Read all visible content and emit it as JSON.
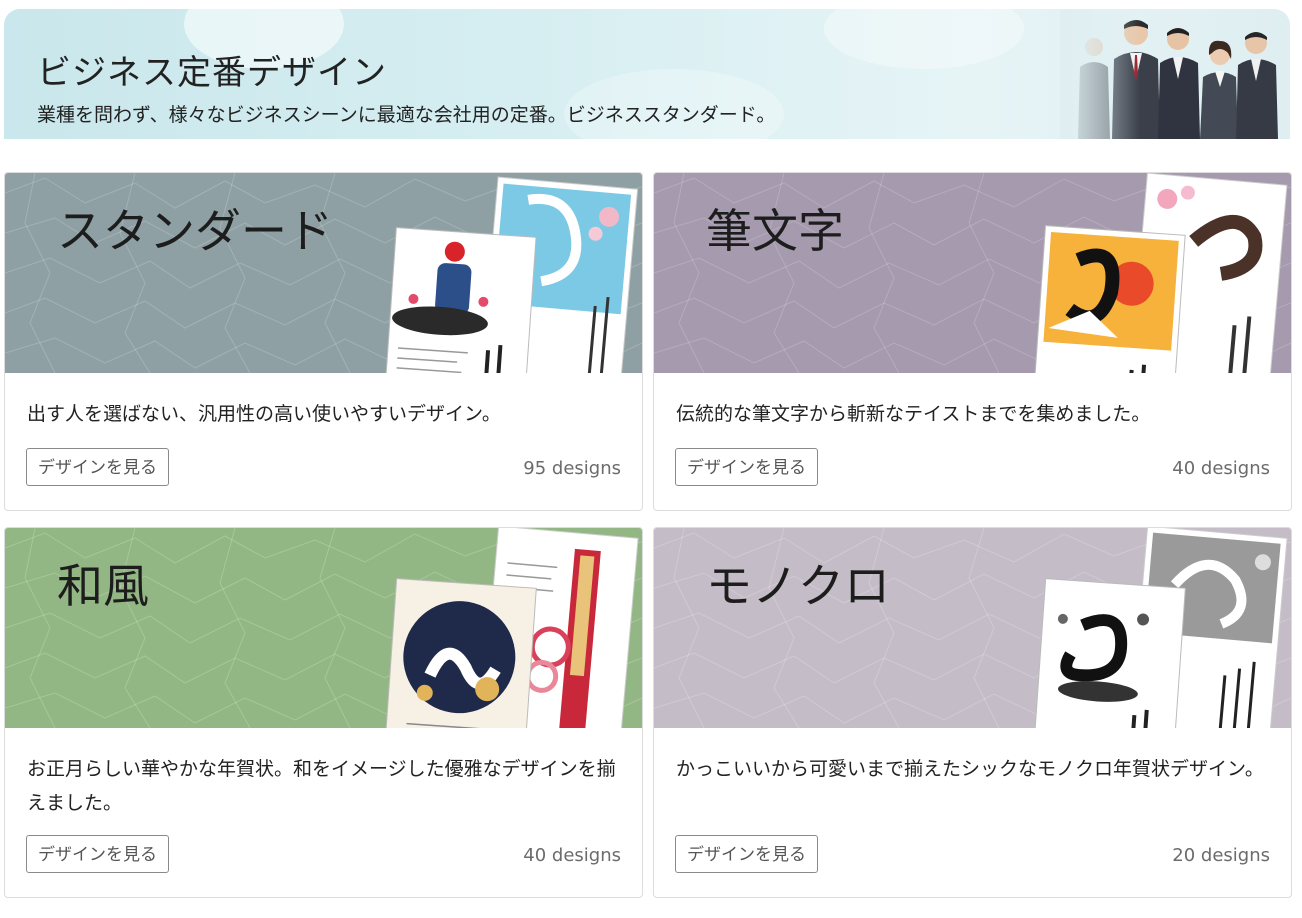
{
  "hero": {
    "title": "ビジネス定番デザイン",
    "subtitle": "業種を問わず、様々なビジネスシーンに最適な会社用の定番。ビジネススタンダード。"
  },
  "categories": [
    {
      "title": "スタンダード",
      "description": "出す人を選ばない、汎用性の高い使いやすいデザイン。",
      "button": "デザインを見る",
      "count": "95 designs",
      "banner_color": "#8fa0a4"
    },
    {
      "title": "筆文字",
      "description": "伝統的な筆文字から斬新なテイストまでを集めました。",
      "button": "デザインを見る",
      "count": "40 designs",
      "banner_color": "#a69aae"
    },
    {
      "title": "和風",
      "description": "お正月らしい華やかな年賀状。和をイメージした優雅なデザインを揃えました。",
      "button": "デザインを見る",
      "count": "40 designs",
      "banner_color": "#93b784"
    },
    {
      "title": "モノクロ",
      "description": "かっこいいから可愛いまで揃えたシックなモノクロ年賀状デザイン。",
      "button": "デザインを見る",
      "count": "20 designs",
      "banner_color": "#c4bcc6"
    }
  ]
}
